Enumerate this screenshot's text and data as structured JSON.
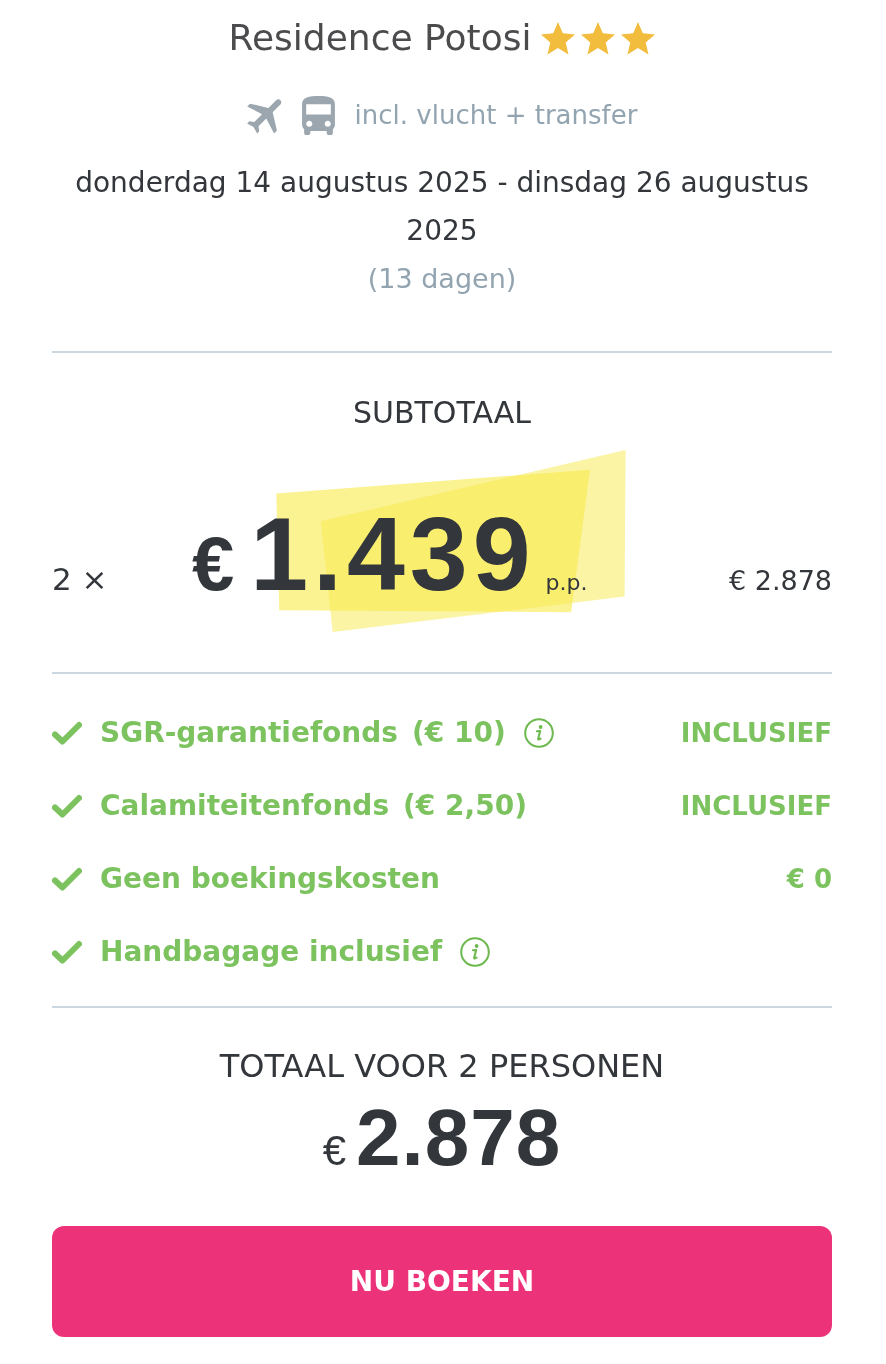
{
  "hotel": {
    "name": "Residence Potosi",
    "stars": 3
  },
  "travel": {
    "includes": "incl. vlucht + transfer"
  },
  "dates": {
    "range": "donderdag 14 augustus 2025 - dinsdag 26 augustus 2025",
    "duration": "(13 dagen)"
  },
  "subtotal": {
    "title": "SUBTOTAAL",
    "quantity": "2 ×",
    "currency": "€",
    "price": "1.439",
    "unit": "p.p.",
    "amount": "€ 2.878"
  },
  "items": [
    {
      "label": "SGR-garantiefonds",
      "detail": "(€ 10)",
      "info": true,
      "value": "INCLUSIEF"
    },
    {
      "label": "Calamiteitenfonds",
      "detail": "(€ 2,50)",
      "info": false,
      "value": "INCLUSIEF"
    },
    {
      "label": "Geen boekingskosten",
      "info": false,
      "value": "€ 0"
    },
    {
      "label": "Handbagage inclusief",
      "info": true
    }
  ],
  "total": {
    "title": "TOTAAL VOOR 2 PERSONEN",
    "currency": "€",
    "amount": "2.878"
  },
  "button": {
    "label": "NU BOEKEN"
  }
}
